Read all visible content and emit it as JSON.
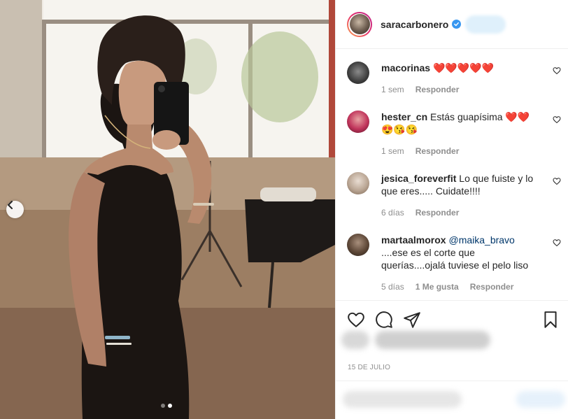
{
  "post": {
    "username": "saracarbonero",
    "verified": true,
    "date": "15 DE JULIO",
    "carousel": {
      "slides": 2,
      "active": 2
    }
  },
  "comments": [
    {
      "user": "macorinas",
      "mention": "",
      "text": "❤️❤️❤️❤️❤️",
      "text2": "",
      "time": "1 sem",
      "likes": "",
      "reply": "Responder"
    },
    {
      "user": "hester_cn",
      "mention": "",
      "text": "Estás guapísima ❤️❤️",
      "text2": "😍😘😘",
      "time": "1 sem",
      "likes": "",
      "reply": "Responder"
    },
    {
      "user": "jesica_foreverfit",
      "mention": "",
      "text": "Lo que fuiste y lo que eres..... Cuidate!!!!",
      "text2": "",
      "time": "6 días",
      "likes": "",
      "reply": "Responder"
    },
    {
      "user": "martaalmorox",
      "mention": "@maika_bravo",
      "text": "....ese es el corte que querías....ojalá tuviese el pelo liso",
      "text2": "",
      "time": "5 días",
      "likes": "1 Me gusta",
      "reply": "Responder"
    }
  ],
  "icons": {
    "like": "heart-icon",
    "comment": "comment-icon",
    "share": "share-icon",
    "save": "bookmark-icon",
    "prev": "chevron-left-icon",
    "verified": "verified-badge-icon"
  },
  "colors": {
    "accent": "#3897f0",
    "mention": "#00376b",
    "muted": "#8e8e8e",
    "text": "#262626"
  }
}
